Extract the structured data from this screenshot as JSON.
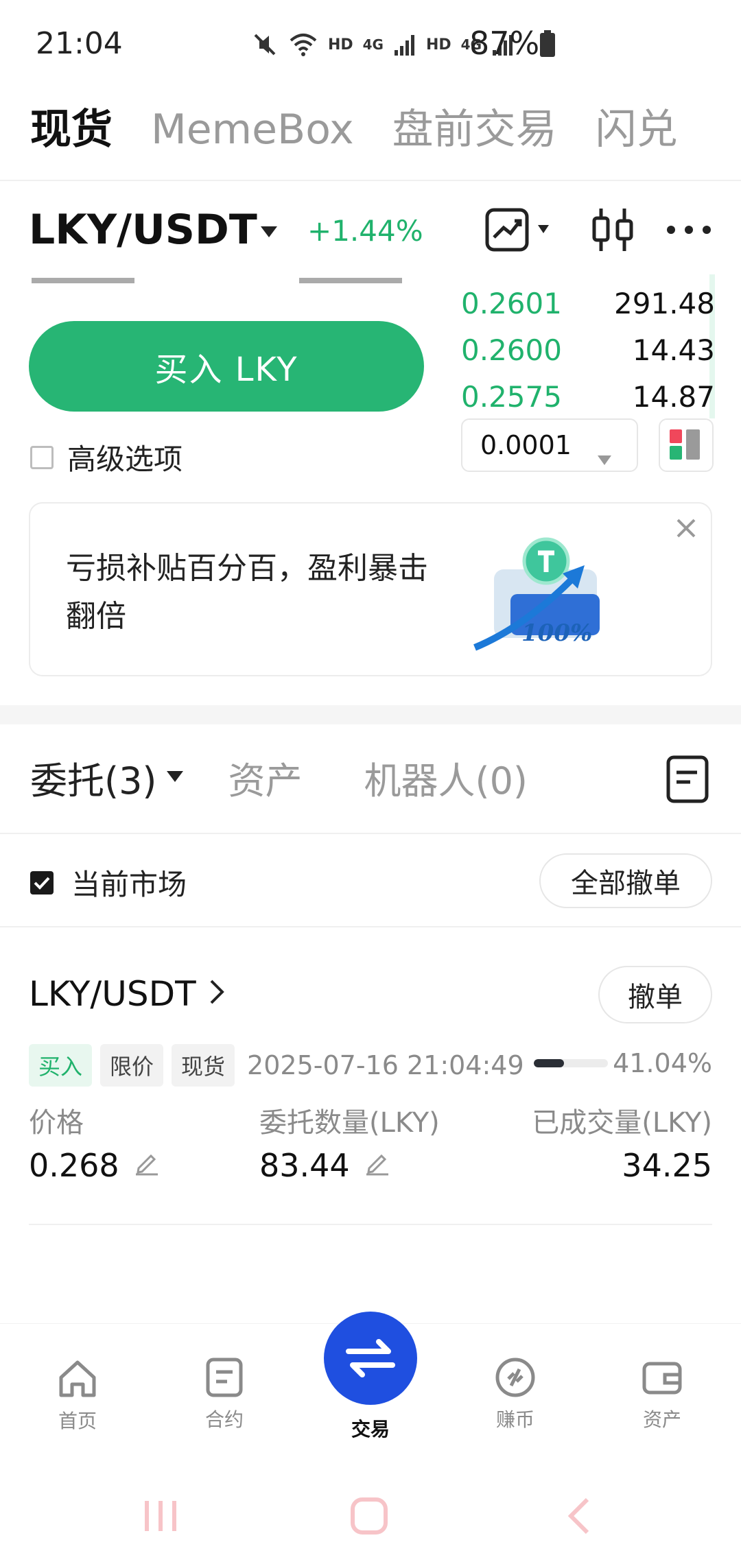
{
  "status_bar": {
    "time": "21:04",
    "hd1": "HD",
    "net1": "4G",
    "hd2": "HD",
    "net2": "4G",
    "battery": "87%"
  },
  "top_tabs": [
    "现货",
    "MemeBox",
    "盘前交易",
    "闪兑"
  ],
  "pair": {
    "name": "LKY/USDT",
    "change": "+1.44%"
  },
  "order_form": {
    "buy_label": "买入 LKY",
    "advanced_label": "高级选项"
  },
  "order_book": {
    "rows": [
      {
        "price": "0.2601",
        "qty": "291.48"
      },
      {
        "price": "0.2600",
        "qty": "14.43"
      },
      {
        "price": "0.2575",
        "qty": "14.87"
      }
    ],
    "precision": "0.0001"
  },
  "banner": {
    "text": "亏损补贴百分百，盈利暴击翻倍",
    "badge": "100%"
  },
  "orders_section": {
    "tabs": [
      "委托(3)",
      "资产",
      "机器人(0)"
    ],
    "filter_label": "当前市场",
    "cancel_all": "全部撤单"
  },
  "order": {
    "pair": "LKY/USDT",
    "cancel": "撤单",
    "tags": [
      "买入",
      "限价",
      "现货"
    ],
    "time": "2025-07-16 21:04:49",
    "progress_text": "41.04%",
    "progress": 0.4104,
    "price_label": "价格",
    "price": "0.268",
    "amount_label": "委托数量(LKY)",
    "amount": "83.44",
    "filled_label": "已成交量(LKY)",
    "filled": "34.25"
  },
  "bottom_nav": [
    "首页",
    "合约",
    "交易",
    "赚币",
    "资产"
  ],
  "colors": {
    "green": "#20b26c",
    "buy_button": "#27b574",
    "trade_fab": "#1f4fe0"
  }
}
